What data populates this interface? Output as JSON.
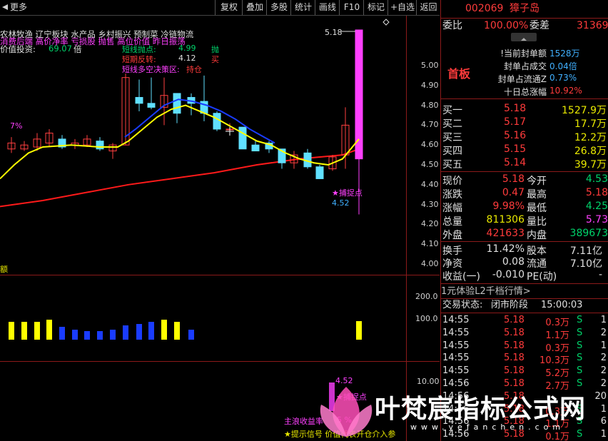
{
  "toolbar": {
    "items": [
      "更多",
      "复权",
      "叠加",
      "多股",
      "统计",
      "画线",
      "F10",
      "标记",
      "+自选",
      "返回"
    ]
  },
  "chart": {
    "price_axis": [
      "5.00",
      "4.90",
      "4.80",
      "4.70",
      "4.60",
      "4.50",
      "4.40",
      "4.30",
      "4.20",
      "4.10",
      "4.00"
    ],
    "vol_axis": [
      "200.0",
      "100.0"
    ],
    "ind_axis": [
      "10.00"
    ],
    "max_label": "5.18",
    "min_label": "4.52",
    "capture_label": "★捕捉点",
    "pct_label": "7%",
    "sector_text": "农林牧渔  辽宁板块  水产品 乡村振兴 预制菜 冷链物流",
    "concept_text": "消费后端 高价净率 亏损股 抛售 高位价值 昨日振荡",
    "value_label": "价值投资:",
    "value_num": "69.07",
    "value_unit": "倍",
    "short_throw_label": "短线抛点:",
    "short_throw_val": "4.99",
    "short_throw_action": "抛",
    "short_rebound_label": "短期反转:",
    "short_rebound_val": "4.12",
    "short_rebound_action": "买",
    "decision_label": "短线多空决策区:",
    "decision_val": "持仓",
    "ind_min_label": "4.52",
    "ind_capture_label": "★捕捉点",
    "profit_label": "主浪收益率",
    "profit_val": "5 %",
    "tip_text": "★提示信号 价值代表开仓介入参",
    "left_edge_char": "额"
  },
  "quote": {
    "code": "002069",
    "name": "獐子岛",
    "weibi_label": "委比",
    "weibi_val": "100.00%",
    "weicha_label": "委差",
    "weicha_val": "31369",
    "status": "首板",
    "stats": [
      {
        "label": "!当前封单额",
        "value": "1528万"
      },
      {
        "label": "封单占成交",
        "value": "0.04倍"
      },
      {
        "label": "封单占流通Z",
        "value": "0.73%"
      },
      {
        "label": "十日总涨幅",
        "value": "10.92%"
      }
    ],
    "bids": [
      {
        "label": "买一",
        "price": "5.18",
        "vol": "1527.9万"
      },
      {
        "label": "买二",
        "price": "5.17",
        "vol": "17.7万"
      },
      {
        "label": "买三",
        "price": "5.16",
        "vol": "12.2万"
      },
      {
        "label": "买四",
        "price": "5.15",
        "vol": "26.8万"
      },
      {
        "label": "买五",
        "price": "5.14",
        "vol": "39.7万"
      }
    ],
    "fields": [
      {
        "l1": "现价",
        "v1": "5.18",
        "l2": "今开",
        "v2": "4.53"
      },
      {
        "l1": "涨跌",
        "v1": "0.47",
        "l2": "最高",
        "v2": "5.18"
      },
      {
        "l1": "涨幅",
        "v1": "9.98%",
        "l2": "最低",
        "v2": "4.25"
      },
      {
        "l1": "总量",
        "v1": "811306",
        "l2": "量比",
        "v2": "5.73"
      },
      {
        "l1": "外盘",
        "v1": "421633",
        "l2": "内盘",
        "v2": "389673"
      }
    ],
    "fields2": [
      {
        "l1": "换手",
        "v1": "11.42%",
        "l2": "股本",
        "v2": "7.11亿"
      },
      {
        "l1": "净资",
        "v1": "0.08",
        "l2": "流通",
        "v2": "7.10亿"
      },
      {
        "l1": "收益(一)",
        "v1": "-0.010",
        "l2": "PE(动)",
        "v2": "-"
      }
    ],
    "l2_banner": "1元体验L2千档行情>",
    "trade_status_label": "交易状态:",
    "trade_status_val": "闭市阶段",
    "trade_time": "15:00:03",
    "ticks": [
      {
        "time": "14:55",
        "price": "5.18",
        "vol": "0.3万",
        "side": "S",
        "n": "1"
      },
      {
        "time": "14:55",
        "price": "5.18",
        "vol": "1.1万",
        "side": "S",
        "n": "2"
      },
      {
        "time": "14:55",
        "price": "5.18",
        "vol": "0.3万",
        "side": "S",
        "n": "1"
      },
      {
        "time": "14:55",
        "price": "5.18",
        "vol": "10.3万",
        "side": "S",
        "n": "2"
      },
      {
        "time": "14:55",
        "price": "5.18",
        "vol": "5.2万",
        "side": "S",
        "n": "2"
      },
      {
        "time": "14:56",
        "price": "5.18",
        "vol": "2.7万",
        "side": "S",
        "n": "2"
      },
      {
        "time": "14:56",
        "price": "5.18",
        "vol": "",
        "side": "",
        "n": "20"
      },
      {
        "time": "14:56",
        "price": "5.18",
        "vol": "0.3万",
        "side": "S",
        "n": "1"
      },
      {
        "time": "14:56",
        "price": "5.18",
        "vol": "1.1万",
        "side": "S",
        "n": "6"
      },
      {
        "time": "14:56",
        "price": "5.18",
        "vol": "0.1万",
        "side": "S",
        "n": "1"
      }
    ]
  },
  "watermark": {
    "text": "叶梵宸指标公式网",
    "url": "www.yefanchen.com"
  },
  "colors": {
    "up": "#ff3b3b",
    "down": "#00d26a",
    "grid": "#8b1a1a",
    "ma_red": "#ff1a1a",
    "ma_blue": "#1a3cff",
    "ma_yellow": "#ffff00",
    "candle_up": "#ff4040",
    "candle_down": "#60e0ff",
    "magenta": "#ff40ff"
  }
}
